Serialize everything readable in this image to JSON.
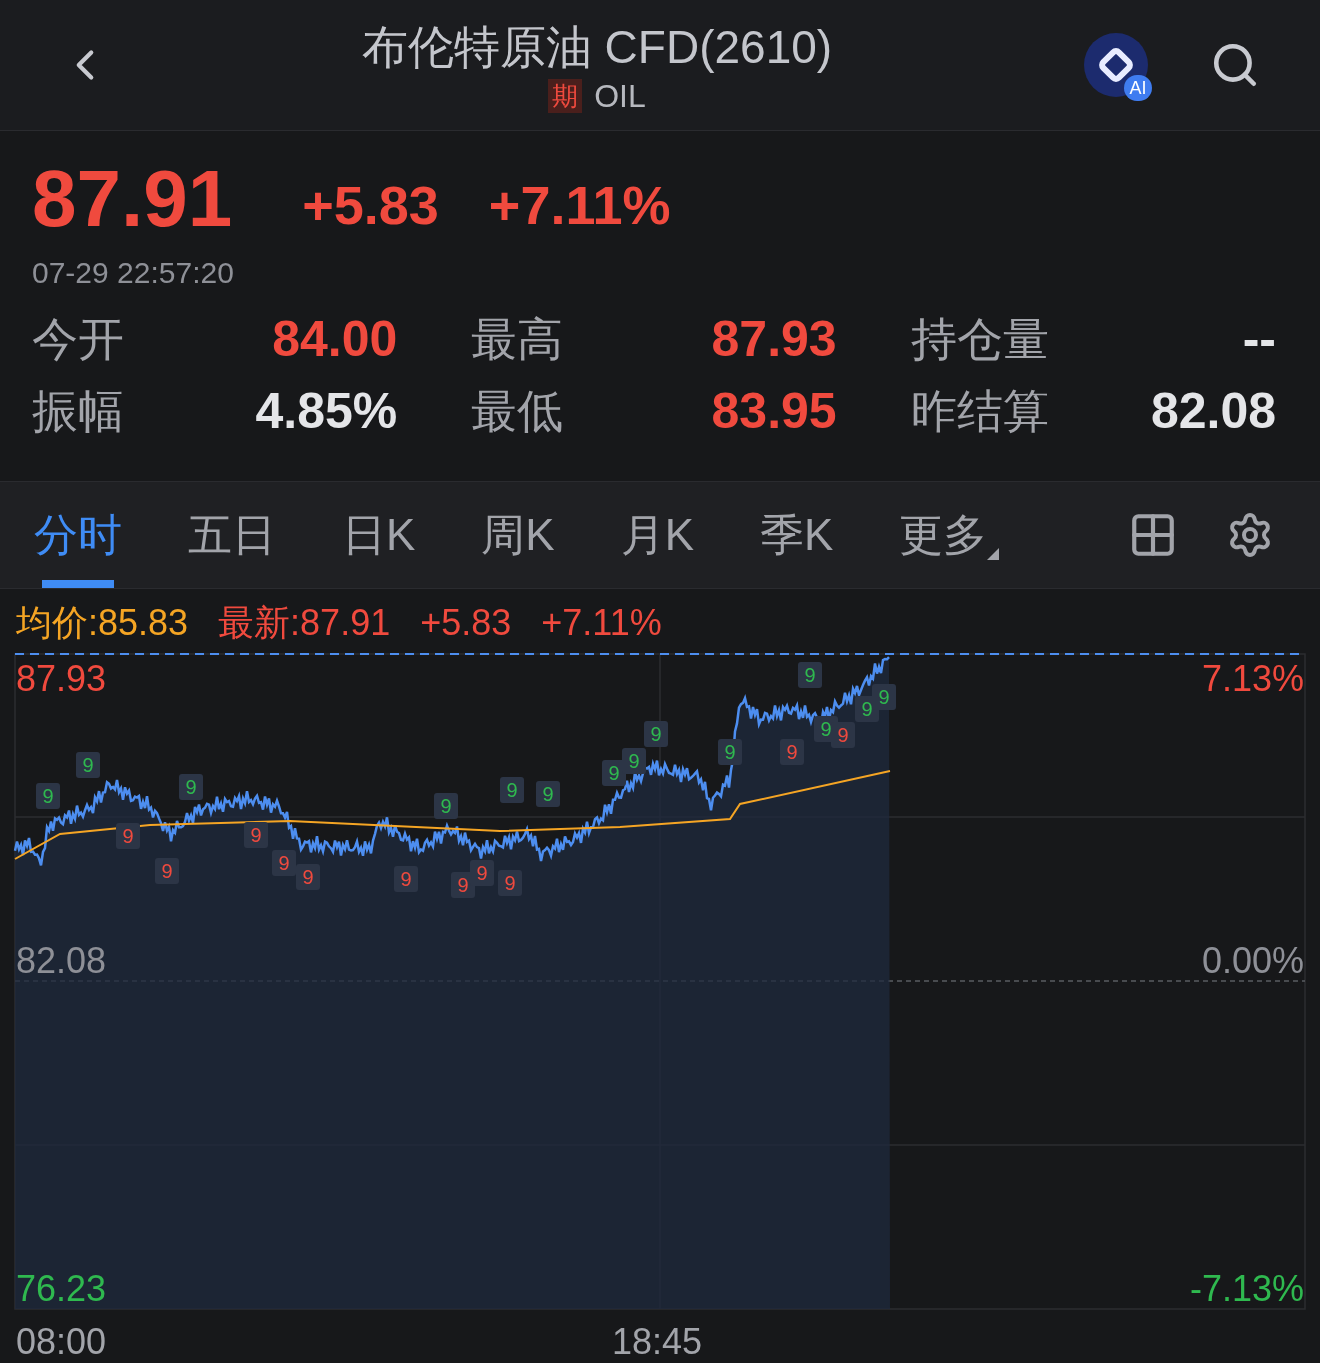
{
  "header": {
    "title": "布伦特原油 CFD(2610)",
    "badge": "期",
    "symbol": "OIL",
    "ai_label": "AI"
  },
  "quote": {
    "price": "87.91",
    "change": "+5.83",
    "change_pct": "+7.11%",
    "time": "07-29 22:57:20"
  },
  "stats": [
    {
      "label": "今开",
      "value": "84.00",
      "color": "#f04a3e"
    },
    {
      "label": "最高",
      "value": "87.93",
      "color": "#f04a3e"
    },
    {
      "label": "持仓量",
      "value": "--",
      "color": "#e4e5e8"
    },
    {
      "label": "振幅",
      "value": "4.85%",
      "color": "#e4e5e8"
    },
    {
      "label": "最低",
      "value": "83.95",
      "color": "#f04a3e"
    },
    {
      "label": "昨结算",
      "value": "82.08",
      "color": "#e4e5e8"
    }
  ],
  "tabs": [
    {
      "label": "分时",
      "selected": true
    },
    {
      "label": "五日",
      "selected": false
    },
    {
      "label": "日K",
      "selected": false
    },
    {
      "label": "周K",
      "selected": false
    },
    {
      "label": "月K",
      "selected": false
    },
    {
      "label": "季K",
      "selected": false
    },
    {
      "label": "更多",
      "selected": false,
      "kind": "menu"
    }
  ],
  "chart": {
    "legend": [
      {
        "text": "均价:85.83",
        "color": "#f5a524"
      },
      {
        "text": "最新:87.91",
        "color": "#f04a3e"
      },
      {
        "text": "+5.83",
        "color": "#f04a3e"
      },
      {
        "text": "+7.11%",
        "color": "#f04a3e"
      }
    ],
    "left_labels": [
      {
        "text": "87.93",
        "kind": "up"
      },
      {
        "text": "82.08",
        "kind": "flat"
      },
      {
        "text": "76.23",
        "kind": "down"
      }
    ],
    "right_labels": [
      {
        "text": "7.13%",
        "kind": "up"
      },
      {
        "text": "0.00%",
        "kind": "flat"
      },
      {
        "text": "-7.13%",
        "kind": "down"
      }
    ],
    "x_labels": [
      "08:00",
      "18:45"
    ],
    "markers": [
      {
        "text": "9",
        "kind": "up"
      },
      {
        "text": "9",
        "kind": "up"
      },
      {
        "text": "9",
        "kind": "up"
      },
      {
        "text": "9",
        "kind": "up"
      },
      {
        "text": "9",
        "kind": "up"
      },
      {
        "text": "9",
        "kind": "up"
      },
      {
        "text": "9",
        "kind": "up"
      },
      {
        "text": "9",
        "kind": "up"
      },
      {
        "text": "9",
        "kind": "up"
      },
      {
        "text": "9",
        "kind": "up"
      },
      {
        "text": "9",
        "kind": "up"
      },
      {
        "text": "9",
        "kind": "up"
      },
      {
        "text": "9",
        "kind": "up"
      },
      {
        "text": "9",
        "kind": "up"
      },
      {
        "text": "9",
        "kind": "down"
      },
      {
        "text": "9",
        "kind": "down"
      },
      {
        "text": "9",
        "kind": "down"
      },
      {
        "text": "9",
        "kind": "down"
      },
      {
        "text": "9",
        "kind": "down"
      },
      {
        "text": "9",
        "kind": "down"
      },
      {
        "text": "9",
        "kind": "down"
      },
      {
        "text": "9",
        "kind": "down"
      },
      {
        "text": "9",
        "kind": "down"
      },
      {
        "text": "9",
        "kind": "down"
      },
      {
        "text": "9",
        "kind": "down"
      }
    ]
  }
}
